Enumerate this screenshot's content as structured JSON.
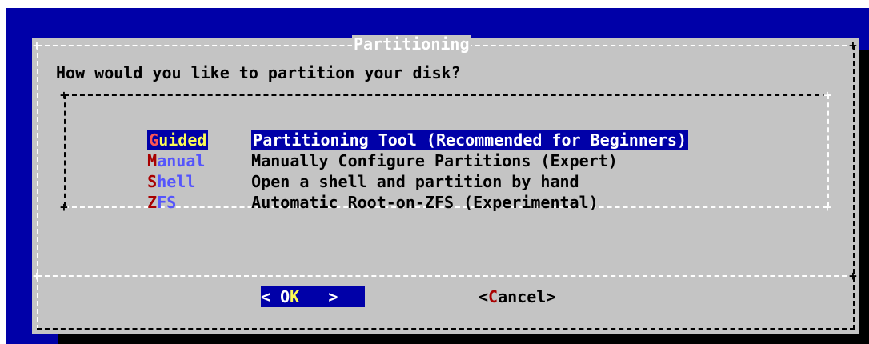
{
  "dialog": {
    "title": "Partitioning",
    "prompt": "How would you like to partition your disk?"
  },
  "menu": {
    "items": [
      {
        "tag_hot": "G",
        "tag_rest": "uided",
        "description": "Partitioning Tool (Recommended for Beginners)",
        "selected": true
      },
      {
        "tag_hot": "M",
        "tag_rest": "anual",
        "description": "Manually Configure Partitions (Expert)",
        "selected": false
      },
      {
        "tag_hot": "S",
        "tag_rest": "hell",
        "description": "Open a shell and partition by hand",
        "selected": false
      },
      {
        "tag_hot": "Z",
        "tag_rest": "FS",
        "description": "Automatic Root-on-ZFS (Experimental)",
        "selected": false
      }
    ]
  },
  "buttons": {
    "ok": {
      "left": "<",
      "pre": " O",
      "hot": "K",
      "right": ">"
    },
    "cancel": {
      "open": "<",
      "hot": "C",
      "rest": "ancel",
      "close": ">"
    }
  },
  "colors": {
    "screen_bg": "#0000a8",
    "dialog_bg": "#c4c4c4",
    "highlight_bg": "#0000a8",
    "hotkey_red": "#a80000",
    "hotkey_yellow": "#fcfc54",
    "tag_blue": "#5454fc"
  }
}
